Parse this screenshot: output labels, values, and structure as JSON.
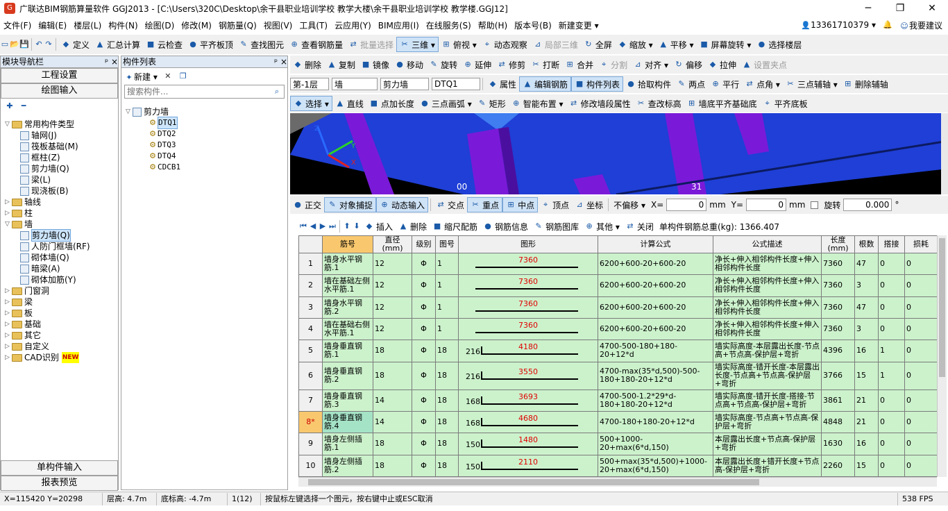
{
  "window": {
    "title": "广联达BIM钢筋算量软件 GGJ2013 - [C:\\Users\\320C\\Desktop\\余干县职业培训学校  教学大楼\\余干县职业培训学校  教学楼.GGJ12]",
    "minimize": "─",
    "restore": "❐",
    "close": "✕"
  },
  "menu": {
    "items": [
      "文件(F)",
      "编辑(E)",
      "楼层(L)",
      "构件(N)",
      "绘图(D)",
      "修改(M)",
      "钢筋量(Q)",
      "视图(V)",
      "工具(T)",
      "云应用(Y)",
      "BIM应用(I)",
      "在线服务(S)",
      "帮助(H)",
      "版本号(B)",
      "新建变更 ▾"
    ],
    "user": "13361710379 ▾",
    "advice": "我要建议"
  },
  "toolbar1": {
    "items": [
      "定义",
      "汇总计算",
      "云检查",
      "平齐板顶",
      "查找图元",
      "查看钢筋量",
      "批量选择",
      "三维 ▾",
      "俯视 ▾",
      "动态观察",
      "局部三维",
      "全屏",
      "缩放 ▾",
      "平移 ▾",
      "屏幕旋转 ▾",
      "选择楼层"
    ]
  },
  "toolbar2": {
    "items": [
      "删除",
      "复制",
      "镜像",
      "移动",
      "旋转",
      "延伸",
      "修剪",
      "打断",
      "合并",
      "分割",
      "对齐 ▾",
      "偏移",
      "拉伸",
      "设置夹点"
    ]
  },
  "toolbar3": {
    "floor": "第-1层",
    "type": "墙",
    "subtype": "剪力墙",
    "component": "DTQ1",
    "items": [
      "属性",
      "编辑钢筋",
      "构件列表",
      "拾取构件",
      "两点",
      "平行",
      "点角 ▾",
      "三点辅轴 ▾",
      "删除辅轴"
    ]
  },
  "toolbar4": {
    "items": [
      "选择 ▾",
      "直线",
      "点加长度",
      "三点画弧 ▾",
      "矩形",
      "智能布置 ▾",
      "修改墙段属性",
      "查改标高",
      "墙底平齐基础底",
      "平齐底板"
    ]
  },
  "snapbar": {
    "items": [
      "正交",
      "对象捕捉",
      "动态输入",
      "交点",
      "重点",
      "中点",
      "顶点",
      "坐标"
    ],
    "offset": "不偏移 ▾",
    "x_label": "X=",
    "x_val": "0",
    "mm1": "mm",
    "y_label": "Y=",
    "y_val": "0",
    "mm2": "mm",
    "rotate": "旋转",
    "rotate_val": "0.000",
    "deg": "°"
  },
  "rebarbar": {
    "items": [
      "插入",
      "删除",
      "缩尺配筋",
      "钢筋信息",
      "钢筋图库",
      "其他 ▾",
      "关闭"
    ],
    "total": "单构件钢筋总重(kg): 1366.407"
  },
  "nav": {
    "title": "模块导航栏",
    "pin": "ᵖ ×",
    "btn_project": "工程设置",
    "btn_draw": "绘图输入",
    "btn_single": "单构件输入",
    "btn_report": "报表预览",
    "tree": [
      {
        "label": "常用构件类型",
        "level": 0,
        "folder": true,
        "open": true
      },
      {
        "label": "轴网(J)",
        "level": 1
      },
      {
        "label": "筏板基础(M)",
        "level": 1
      },
      {
        "label": "框柱(Z)",
        "level": 1
      },
      {
        "label": "剪力墙(Q)",
        "level": 1
      },
      {
        "label": "梁(L)",
        "level": 1
      },
      {
        "label": "现浇板(B)",
        "level": 1
      },
      {
        "label": "轴线",
        "level": 0,
        "folder": true
      },
      {
        "label": "柱",
        "level": 0,
        "folder": true
      },
      {
        "label": "墙",
        "level": 0,
        "folder": true,
        "open": true
      },
      {
        "label": "剪力墙(Q)",
        "level": 1,
        "selected": true
      },
      {
        "label": "人防门框墙(RF)",
        "level": 1
      },
      {
        "label": "砌体墙(Q)",
        "level": 1
      },
      {
        "label": "暗梁(A)",
        "level": 1
      },
      {
        "label": "砌体加筋(Y)",
        "level": 1
      },
      {
        "label": "门窗洞",
        "level": 0,
        "folder": true
      },
      {
        "label": "梁",
        "level": 0,
        "folder": true
      },
      {
        "label": "板",
        "level": 0,
        "folder": true
      },
      {
        "label": "基础",
        "level": 0,
        "folder": true
      },
      {
        "label": "其它",
        "level": 0,
        "folder": true
      },
      {
        "label": "自定义",
        "level": 0,
        "folder": true
      },
      {
        "label": "CAD识别",
        "level": 0,
        "folder": true,
        "badge": "NEW"
      }
    ]
  },
  "complist": {
    "title": "构件列表",
    "pin": "ᵖ ×",
    "new_btn": "新建 ▾",
    "search_placeholder": "搜索构件...",
    "root": "剪力墙",
    "items": [
      "DTQ1",
      "DTQ2",
      "DTQ3",
      "DTQ4",
      "CDCB1"
    ]
  },
  "view3d": {
    "label_left": "00",
    "label_right": "31"
  },
  "table": {
    "headers": [
      "",
      "筋号",
      "直径(mm)",
      "级别",
      "图号",
      "图形",
      "计算公式",
      "公式描述",
      "长度(mm)",
      "根数",
      "搭接",
      "损耗"
    ],
    "rows": [
      {
        "no": "1",
        "name": "墙身水平钢筋.1",
        "dia": "12",
        "grade": "Φ",
        "fig": "1",
        "left": "",
        "shape": "7360",
        "formula": "6200+600-20+600-20",
        "desc": "净长+伸入相邻构件长度+伸入相邻构件长度",
        "len": "7360",
        "count": "47",
        "lap": "0",
        "loss": "0"
      },
      {
        "no": "2",
        "name": "墙在基础左侧水平筋.1",
        "dia": "12",
        "grade": "Φ",
        "fig": "1",
        "left": "",
        "shape": "7360",
        "formula": "6200+600-20+600-20",
        "desc": "净长+伸入相邻构件长度+伸入相邻构件长度",
        "len": "7360",
        "count": "3",
        "lap": "0",
        "loss": "0"
      },
      {
        "no": "3",
        "name": "墙身水平钢筋.2",
        "dia": "12",
        "grade": "Φ",
        "fig": "1",
        "left": "",
        "shape": "7360",
        "formula": "6200+600-20+600-20",
        "desc": "净长+伸入相邻构件长度+伸入相邻构件长度",
        "len": "7360",
        "count": "47",
        "lap": "0",
        "loss": "0"
      },
      {
        "no": "4",
        "name": "墙在基础右侧水平筋.1",
        "dia": "12",
        "grade": "Φ",
        "fig": "1",
        "left": "",
        "shape": "7360",
        "formula": "6200+600-20+600-20",
        "desc": "净长+伸入相邻构件长度+伸入相邻构件长度",
        "len": "7360",
        "count": "3",
        "lap": "0",
        "loss": "0"
      },
      {
        "no": "5",
        "name": "墙身垂直钢筋.1",
        "dia": "18",
        "grade": "Φ",
        "fig": "18",
        "left": "216",
        "shape": "4180",
        "formula": "4700-500-180+180-20+12*d",
        "desc": "墙实际高度-本层露出长度-节点高+节点高-保护层+弯折",
        "len": "4396",
        "count": "16",
        "lap": "1",
        "loss": "0"
      },
      {
        "no": "6",
        "name": "墙身垂直钢筋.2",
        "dia": "18",
        "grade": "Φ",
        "fig": "18",
        "left": "216",
        "shape": "3550",
        "formula": "4700-max(35*d,500)-500-180+180-20+12*d",
        "desc": "墙实际高度-错开长度-本层露出长度-节点高+节点高-保护层+弯折",
        "len": "3766",
        "count": "15",
        "lap": "1",
        "loss": "0"
      },
      {
        "no": "7",
        "name": "墙身垂直钢筋.3",
        "dia": "14",
        "grade": "Φ",
        "fig": "18",
        "left": "168",
        "shape": "3693",
        "formula": "4700-500-1.2*29*d-180+180-20+12*d",
        "desc": "墙实际高度-错开长度-搭接-节点高+节点高-保护层+弯折",
        "len": "3861",
        "count": "21",
        "lap": "0",
        "loss": "0"
      },
      {
        "no": "8*",
        "name": "墙身垂直钢筋.4",
        "dia": "14",
        "grade": "Φ",
        "fig": "18",
        "left": "168",
        "shape": "4680",
        "formula": "4700-180+180-20+12*d",
        "desc": "墙实际高度-节点高+节点高-保护层+弯折",
        "len": "4848",
        "count": "21",
        "lap": "0",
        "loss": "0",
        "current": true
      },
      {
        "no": "9",
        "name": "墙身左侧插筋.1",
        "dia": "18",
        "grade": "Φ",
        "fig": "18",
        "left": "150",
        "shape": "1480",
        "formula": "500+1000-20+max(6*d,150)",
        "desc": "本层露出长度+节点高-保护层+弯折",
        "len": "1630",
        "count": "16",
        "lap": "0",
        "loss": "0"
      },
      {
        "no": "10",
        "name": "墙身左侧插筋.2",
        "dia": "18",
        "grade": "Φ",
        "fig": "18",
        "left": "150",
        "shape": "2110",
        "formula": "500+max(35*d,500)+1000-20+max(6*d,150)",
        "desc": "本层露出长度+错开长度+节点高-保护层+弯折",
        "len": "2260",
        "count": "15",
        "lap": "0",
        "loss": "0"
      }
    ]
  },
  "status": {
    "coord": "X=115420  Y=20298",
    "floor_h": "层高: 4.7m",
    "bottom_h": "底标高: -4.7m",
    "count": "1(12)",
    "hint": "按鼠标左键选择一个图元，按右键中止或ESC取消",
    "fps": "538 FPS"
  }
}
